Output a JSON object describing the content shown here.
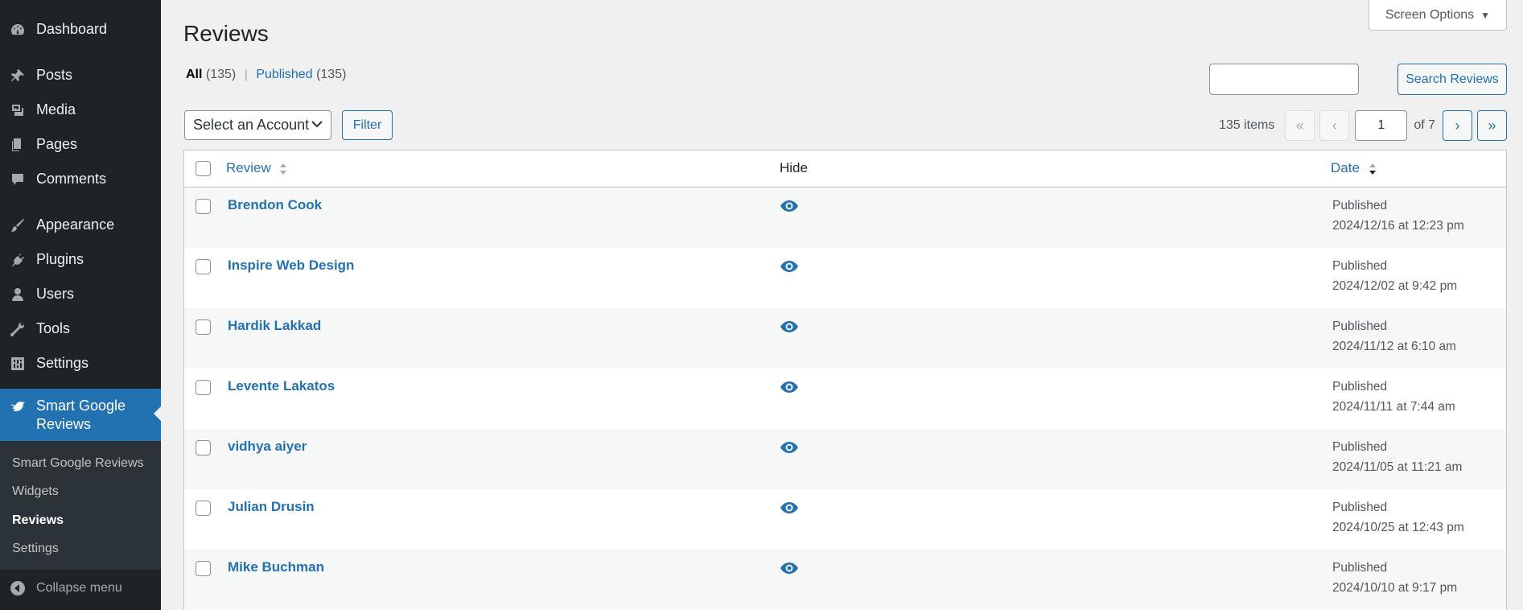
{
  "sidebar": {
    "items": [
      {
        "label": "Dashboard",
        "icon": "dashboard-icon"
      },
      {
        "label": "Posts",
        "icon": "pin-icon"
      },
      {
        "label": "Media",
        "icon": "media-icon"
      },
      {
        "label": "Pages",
        "icon": "pages-icon"
      },
      {
        "label": "Comments",
        "icon": "comment-icon"
      },
      {
        "label": "Appearance",
        "icon": "brush-icon"
      },
      {
        "label": "Plugins",
        "icon": "plug-icon"
      },
      {
        "label": "Users",
        "icon": "user-icon"
      },
      {
        "label": "Tools",
        "icon": "wrench-icon"
      },
      {
        "label": "Settings",
        "icon": "settings-icon"
      },
      {
        "label": "Smart Google Reviews",
        "icon": "bird-icon"
      }
    ],
    "submenu": [
      "Smart Google Reviews",
      "Widgets",
      "Reviews",
      "Settings"
    ],
    "collapse": "Collapse menu"
  },
  "header": {
    "screen_options": "Screen Options",
    "title": "Reviews"
  },
  "views": {
    "all": "All",
    "all_count": "(135)",
    "separator": "|",
    "published": "Published",
    "published_count": "(135)"
  },
  "search": {
    "value": "",
    "button": "Search Reviews"
  },
  "filters": {
    "account_select": "Select an Account",
    "filter_button": "Filter"
  },
  "pagination": {
    "items": "135 items",
    "first": "«",
    "prev": "‹",
    "current_page": "1",
    "of": "of 7",
    "next": "›",
    "last": "»"
  },
  "table": {
    "columns": {
      "review": "Review",
      "hide": "Hide",
      "date": "Date"
    },
    "rows": [
      {
        "name": "Brendon Cook",
        "status": "Published",
        "date": "2024/12/16 at 12:23 pm"
      },
      {
        "name": "Inspire Web Design",
        "status": "Published",
        "date": "2024/12/02 at 9:42 pm"
      },
      {
        "name": "Hardik Lakkad",
        "status": "Published",
        "date": "2024/11/12 at 6:10 am"
      },
      {
        "name": "Levente Lakatos",
        "status": "Published",
        "date": "2024/11/11 at 7:44 am"
      },
      {
        "name": "vidhya aiyer",
        "status": "Published",
        "date": "2024/11/05 at 11:21 am"
      },
      {
        "name": "Julian Drusin",
        "status": "Published",
        "date": "2024/10/25 at 12:43 pm"
      },
      {
        "name": "Mike Buchman",
        "status": "Published",
        "date": "2024/10/10 at 9:17 pm"
      }
    ]
  },
  "colors": {
    "sidebar_bg": "#1d2327",
    "accent": "#2271b1",
    "page_bg": "#f0f0f1"
  }
}
